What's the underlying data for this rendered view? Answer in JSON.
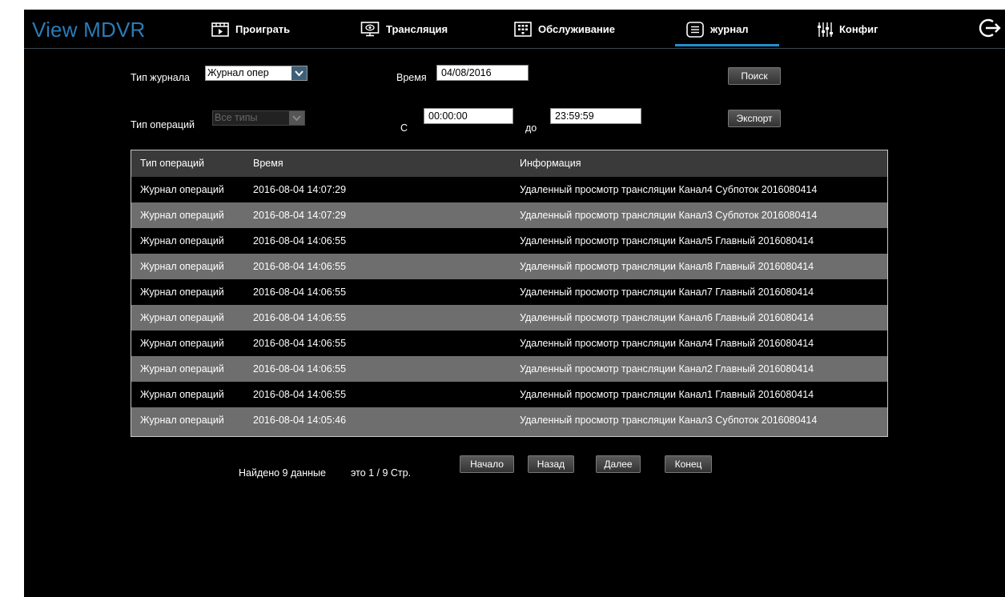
{
  "app": {
    "logo": "View MDVR",
    "nav": [
      {
        "label": "Проиграть",
        "icon": "play-icon"
      },
      {
        "label": "Трансляция",
        "icon": "monitor-icon"
      },
      {
        "label": "Обслуживание",
        "icon": "maintenance-icon"
      },
      {
        "label": "журнал",
        "icon": "log-icon",
        "active": true
      },
      {
        "label": "Конфиг",
        "icon": "config-sliders-icon"
      }
    ],
    "logout_icon": "logout-icon",
    "accent_color": "#1f8fd0",
    "logo_color": "#2a7bb8"
  },
  "filters": {
    "log_type_label": "Тип журнала",
    "log_type_value": "Журнал опер",
    "op_type_label": "Тип операций",
    "op_type_value": "Все типы",
    "time_label": "Время",
    "date_value": "04/08/2016",
    "from_label": "С",
    "from_value": "00:00:00",
    "to_label": "до",
    "to_value": "23:59:59",
    "search_button": "Поиск",
    "export_button": "Экспорт"
  },
  "table": {
    "headers": [
      "Тип операций",
      "Время",
      "Информация"
    ],
    "rows": [
      [
        "Журнал операций",
        "2016-08-04 14:07:29",
        "Удаленный просмотр трансляции Канал4 Субпоток 2016080414"
      ],
      [
        "Журнал операций",
        "2016-08-04 14:07:29",
        "Удаленный просмотр трансляции Канал3 Субпоток 2016080414"
      ],
      [
        "Журнал операций",
        "2016-08-04 14:06:55",
        "Удаленный просмотр трансляции Канал5 Главный 2016080414"
      ],
      [
        "Журнал операций",
        "2016-08-04 14:06:55",
        "Удаленный просмотр трансляции Канал8 Главный 2016080414"
      ],
      [
        "Журнал операций",
        "2016-08-04 14:06:55",
        "Удаленный просмотр трансляции Канал7 Главный 2016080414"
      ],
      [
        "Журнал операций",
        "2016-08-04 14:06:55",
        "Удаленный просмотр трансляции Канал6 Главный 2016080414"
      ],
      [
        "Журнал операций",
        "2016-08-04 14:06:55",
        "Удаленный просмотр трансляции Канал4 Главный 2016080414"
      ],
      [
        "Журнал операций",
        "2016-08-04 14:06:55",
        "Удаленный просмотр трансляции Канал2 Главный 2016080414"
      ],
      [
        "Журнал операций",
        "2016-08-04 14:06:55",
        "Удаленный просмотр трансляции Канал1 Главный 2016080414"
      ],
      [
        "Журнал операций",
        "2016-08-04 14:05:46",
        "Удаленный просмотр трансляции Канал3 Субпоток 2016080414"
      ]
    ]
  },
  "pagination": {
    "found_text": "Найдено 9 данные",
    "page_text": "это 1 / 9 Стр.",
    "first_button": "Начало",
    "prev_button": "Назад",
    "next_button": "Далее",
    "last_button": "Конец"
  }
}
